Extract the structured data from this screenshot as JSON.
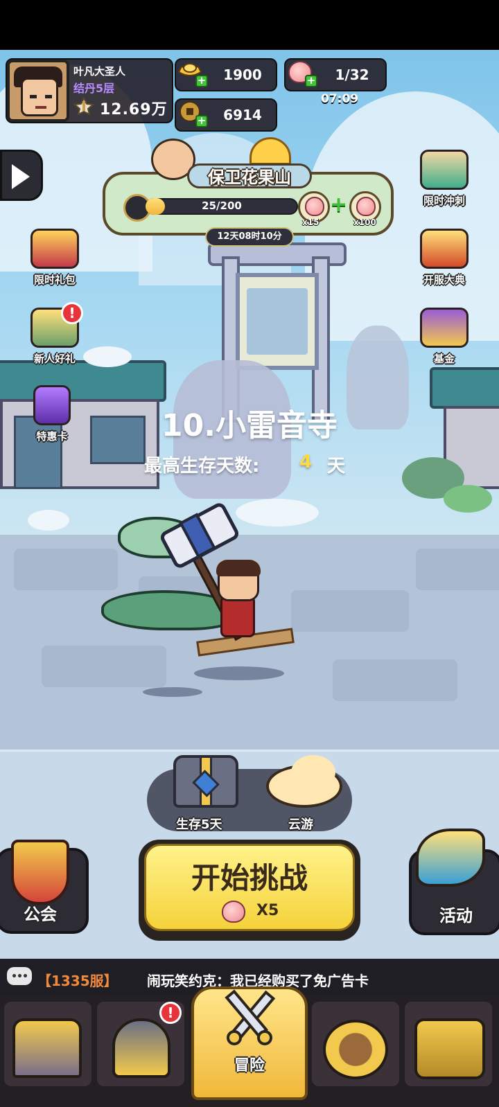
{
  "player": {
    "name": "叶凡大圣人",
    "rank": "结丹5层",
    "power": "12.69万"
  },
  "currencies": {
    "gold_ingot": "1900",
    "coins": "6914",
    "peach_stamina": "1/32",
    "stamina_timer": "07:09"
  },
  "event": {
    "title": "保卫花果山",
    "progress_text": "25/200",
    "progress_fraction": 0.125,
    "reward_small": "x15",
    "reward_large": "x100",
    "time_left": "12天08时10分"
  },
  "side_left": {
    "items": [
      {
        "label": "限时礼包",
        "icon": "gift-bag-icon"
      },
      {
        "label": "新人好礼",
        "icon": "gold-ingot-gift-icon",
        "badge": "!"
      },
      {
        "label": "特惠卡",
        "icon": "vip-card-icon"
      }
    ]
  },
  "side_right": {
    "items": [
      {
        "label": "限时冲刺",
        "icon": "hourglass-icon"
      },
      {
        "label": "开服大典",
        "icon": "drum-icon"
      },
      {
        "label": "基金",
        "icon": "fund-chest-icon"
      }
    ]
  },
  "stage": {
    "title": "10.小雷音寺",
    "survive_label": "最高生存天数:",
    "survive_days": "4",
    "survive_unit": "天"
  },
  "modes": {
    "survive_chest_label": "生存5天",
    "cloud_travel_label": "云游"
  },
  "actions": {
    "start_label": "开始挑战",
    "start_cost": "X5",
    "guild_label": "公会",
    "activity_label": "活动"
  },
  "chat": {
    "server": "【1335服】",
    "message": "闹玩笑约克：我已经购买了免广告卡"
  },
  "nav": {
    "active_label": "冒险",
    "badge": "!"
  },
  "colors": {
    "accent_yellow": "#f5d23a",
    "peach_pink": "#f08a8f",
    "rank_purple": "#b68cff",
    "chat_orange": "#f18a3c"
  }
}
